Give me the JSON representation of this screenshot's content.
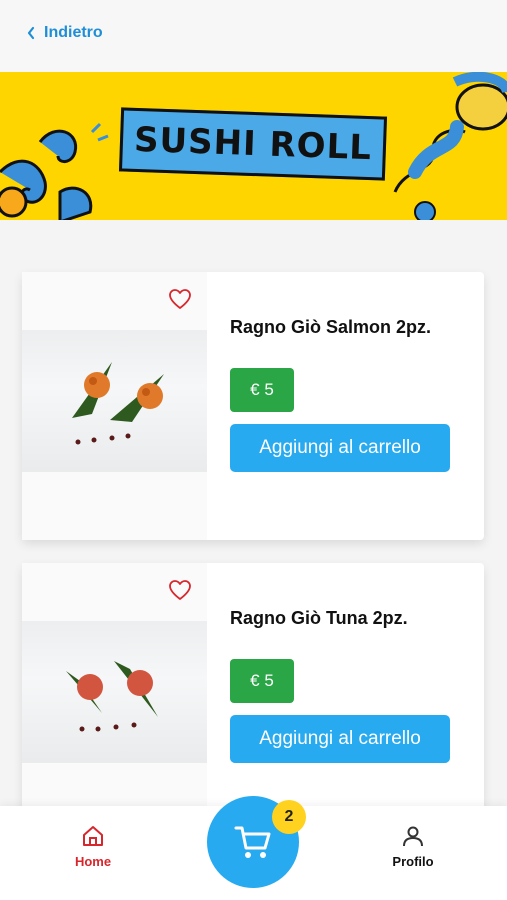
{
  "header": {
    "back_label": "Indietro"
  },
  "banner": {
    "title": "SUSHI ROLL"
  },
  "products": [
    {
      "name": "Ragno Giò Salmon 2pz.",
      "price": "€ 5",
      "add_label": "Aggiungi al carrello"
    },
    {
      "name": "Ragno Giò Tuna 2pz.",
      "price": "€ 5",
      "add_label": "Aggiungi al carrello"
    }
  ],
  "bottom_nav": {
    "home_label": "Home",
    "profile_label": "Profilo",
    "cart_count": "2"
  },
  "icons": {
    "back": "chevron-left-icon",
    "favorite": "heart-outline-icon",
    "home": "home-icon",
    "cart": "cart-icon",
    "profile": "user-icon"
  },
  "colors": {
    "accent_blue": "#27aaf0",
    "link_blue": "#1f8ed6",
    "price_green": "#2aa646",
    "home_red": "#d8262d",
    "banner_yellow": "#ffd500",
    "badge_yellow": "#ffd21f"
  }
}
